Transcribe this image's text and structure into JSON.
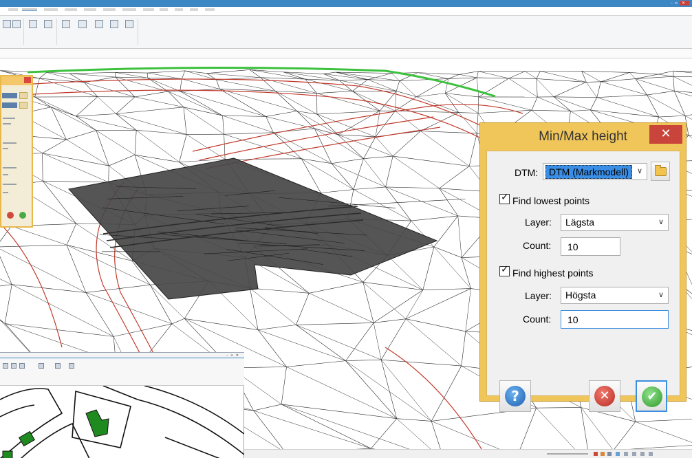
{
  "dialog": {
    "title": "Min/Max height",
    "close_glyph": "✕",
    "dtm_label": "DTM:",
    "dtm_value": "DTM (Markmodell)",
    "find_lowest_label": "Find lowest points",
    "find_lowest_checked": true,
    "lowest_layer_label": "Layer:",
    "lowest_layer_value": "Lägsta",
    "lowest_count_label": "Count:",
    "lowest_count_value": "10",
    "find_highest_label": "Find highest points",
    "find_highest_checked": true,
    "highest_layer_label": "Layer:",
    "highest_layer_value": "Högsta",
    "highest_count_label": "Count:",
    "highest_count_value": "10",
    "help_glyph": "?",
    "cancel_glyph": "✕",
    "ok_glyph": "✔"
  },
  "icons": {
    "dropdown": "chevron-down-icon",
    "browse": "folder-icon",
    "check": "checkmark-icon"
  },
  "colors": {
    "dialog_frame": "#f0c65a",
    "close_button": "#c9443a",
    "focus": "#3b8ee0",
    "window_title": "#3c87c4",
    "surface_dark": "#4a4a4a",
    "mesh_red": "#c0392b"
  }
}
